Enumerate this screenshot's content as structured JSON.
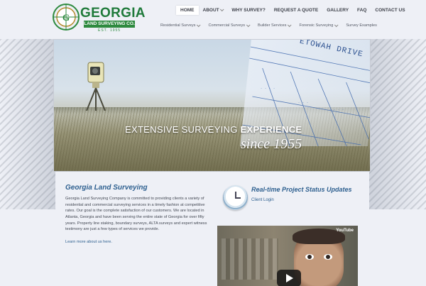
{
  "logo": {
    "name": "GEORGIA",
    "subtitle": "LAND SURVEYING CO.",
    "est": "EST. 1955"
  },
  "topnav": [
    {
      "label": "HOME",
      "active": true
    },
    {
      "label": "ABOUT"
    },
    {
      "label": "WHY SURVEY?"
    },
    {
      "label": "REQUEST A QUOTE"
    },
    {
      "label": "GALLERY"
    },
    {
      "label": "FAQ"
    },
    {
      "label": "CONTACT US"
    }
  ],
  "subnav": [
    {
      "label": "Residential Surveys"
    },
    {
      "label": "Commercial Surveys"
    },
    {
      "label": "Builder Services"
    },
    {
      "label": "Forensic Surveying"
    },
    {
      "label": "Survey Examples"
    }
  ],
  "hero": {
    "road_label": "ETOWAH DRIVE",
    "headline_part1": "EXTENSIVE SURVEYING",
    "headline_part2": "EXPERIENCE",
    "since": "since 1955"
  },
  "intro": {
    "title": "Georgia Land Surveying",
    "body": "Georgia Land Surveying Company is committed to providing clients a variety of residential and commercial surveying services in a timely fashion at competitive rates. Our goal is the complete satisfaction of our customers. We are located in Atlanta, Georgia and have been serving the entire state of Georgia for over fifty years. Property line staking, boundary surveys, ALTA surveys and expert witness testimony are just a few types of services we provide.",
    "link": "Learn more about us here."
  },
  "status": {
    "title": "Real-time Project Status Updates",
    "link": "Client Login"
  },
  "video": {
    "brand": "YouTube"
  }
}
